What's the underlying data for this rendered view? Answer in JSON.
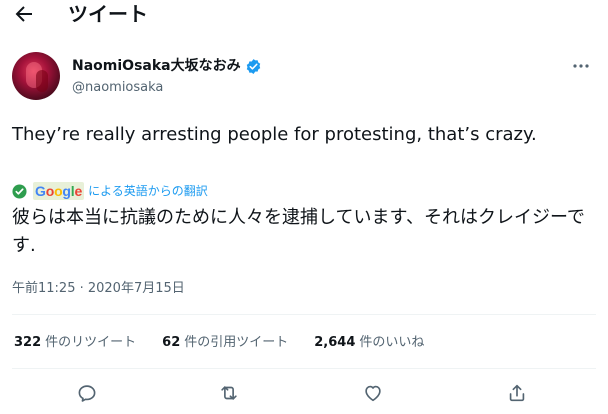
{
  "header": {
    "title": "ツイート",
    "back_icon": "arrow-left-icon"
  },
  "user": {
    "display_name": "NaomiOsaka大坂なおみ",
    "handle": "@naomiosaka",
    "verified": true,
    "verified_color": "#1d9bf0"
  },
  "tweet": {
    "text": "They’re really arresting people for protesting, that’s crazy.",
    "translation_provider": "Google",
    "translation_label": "による英語からの翻訳",
    "translated_text": "彼らは本当に抗議のために人々を逮捕しています、それはクレイジーです.",
    "timestamp": "午前11:25 · 2020年7月15日"
  },
  "stats": {
    "retweets_count": "322",
    "retweets_label": "件のリツイート",
    "quotes_count": "62",
    "quotes_label": "件の引用ツイート",
    "likes_count": "2,644",
    "likes_label": "件のいいね"
  },
  "actions": [
    "reply-icon",
    "retweet-icon",
    "like-icon",
    "share-icon"
  ],
  "colors": {
    "text_primary": "#0f1419",
    "text_secondary": "#536471",
    "accent": "#1d9bf0",
    "divider": "#eff3f4"
  }
}
